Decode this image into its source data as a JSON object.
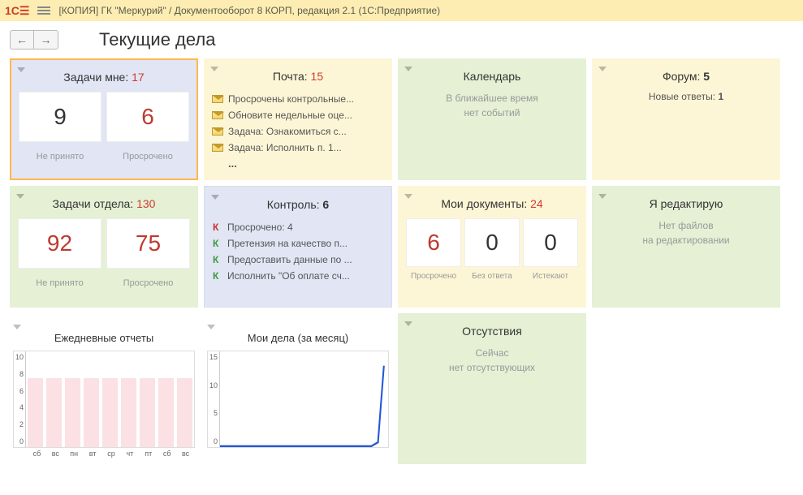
{
  "titlebar": "[КОПИЯ] ГК \"Меркурий\" / Документооборот 8 КОРП, редакция 2.1  (1С:Предприятие)",
  "page_title": "Текущие дела",
  "tasks_me": {
    "title": "Задачи мне:",
    "count": "17",
    "left_val": "9",
    "right_val": "6",
    "left_label": "Не принято",
    "right_label": "Просрочено"
  },
  "mail": {
    "title": "Почта:",
    "count": "15",
    "items": [
      "Просрочены контрольные...",
      "Обновите недельные оце...",
      "Задача: Ознакомиться с...",
      "Задача: Исполнить п. 1..."
    ]
  },
  "calendar": {
    "title": "Календарь",
    "line1": "В ближайшее время",
    "line2": "нет событий"
  },
  "forum": {
    "title": "Форум:",
    "count": "5",
    "line": "Новые ответы:",
    "line_count": "1"
  },
  "tasks_dept": {
    "title": "Задачи отдела:",
    "count": "130",
    "left_val": "92",
    "right_val": "75",
    "left_label": "Не принято",
    "right_label": "Просрочено"
  },
  "control": {
    "title": "Контроль:",
    "count": "6",
    "items": [
      {
        "k": "red",
        "text": "Просрочено: 4"
      },
      {
        "k": "green",
        "text": "Претензия на качество п..."
      },
      {
        "k": "green",
        "text": "Предоставить данные по ..."
      },
      {
        "k": "green",
        "text": "Исполнить \"Об оплате сч..."
      }
    ]
  },
  "mydocs": {
    "title": "Мои документы:",
    "count": "24",
    "vals": [
      "6",
      "0",
      "0"
    ],
    "labels": [
      "Просрочено",
      "Без ответа",
      "Истекают"
    ]
  },
  "editing": {
    "title": "Я редактирую",
    "line1": "Нет файлов",
    "line2": "на редактировании"
  },
  "daily_reports_title": "Ежедневные отчеты",
  "my_cases_title": "Мои дела (за месяц)",
  "absence": {
    "title": "Отсутствия",
    "line1": "Сейчас",
    "line2": "нет отсутствующих"
  },
  "chart_data": [
    {
      "type": "bar",
      "title": "Ежедневные отчеты",
      "categories": [
        "сб",
        "вс",
        "пн",
        "вт",
        "ср",
        "чт",
        "пт",
        "сб",
        "вс"
      ],
      "values": [
        7.5,
        7.5,
        7.5,
        7.5,
        7.5,
        7.5,
        7.5,
        7.5,
        7.5
      ],
      "ylim": [
        0,
        10
      ],
      "yticks": [
        0,
        2,
        4,
        6,
        8,
        10
      ]
    },
    {
      "type": "line",
      "title": "Мои дела (за месяц)",
      "x_range": [
        0,
        30
      ],
      "series": [
        {
          "name": "count",
          "values": [
            0,
            0,
            0,
            0,
            0,
            0,
            0,
            0,
            0,
            0,
            0,
            0,
            0,
            0,
            0,
            0,
            0,
            0,
            0,
            0,
            0,
            0,
            0,
            0,
            0,
            0,
            0,
            0,
            1,
            13
          ]
        }
      ],
      "ylim": [
        0,
        15
      ],
      "yticks": [
        0,
        5,
        10,
        15
      ]
    }
  ]
}
